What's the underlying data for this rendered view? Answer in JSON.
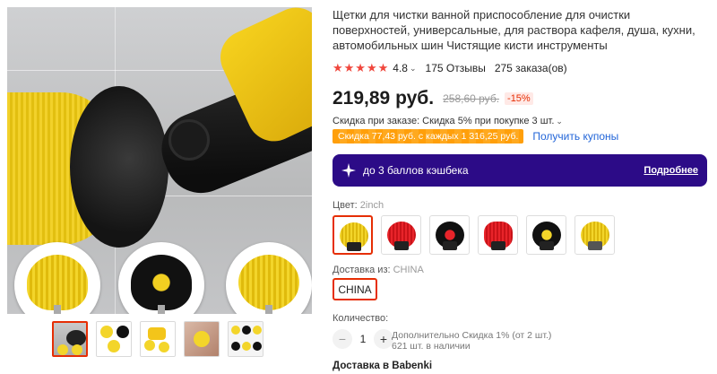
{
  "gallery": {
    "main_alt": "drill brush cleaning tiles",
    "thumbnails": [
      "thumb-1",
      "thumb-2",
      "thumb-3",
      "thumb-4",
      "thumb-5"
    ],
    "active_thumbnail": 0
  },
  "product": {
    "title": "Щетки для чистки ванной приспособление для очистки поверхностей, универсальные, для раствора кафеля, душа, кухни, автомобильных шин Чистящие кисти инструменты",
    "rating": "4.8",
    "stars": "★★★★★",
    "reviews": "175 Отзывы",
    "orders": "275 заказа(ов)"
  },
  "price": {
    "current": "219,89 руб.",
    "old": "258,60 руб.",
    "discount": "-15%"
  },
  "promo": {
    "order_discount": "Скидка при заказе: Скидка 5% при покупке 3 шт.",
    "coupon_tag": "Скидка 77,43 руб. с каждых 1 316,25 руб.",
    "coupon_link": "Получить купоны"
  },
  "cashback": {
    "text": "до 3 баллов кэшбека",
    "more": "Подробнее",
    "bg": "#2c0b87"
  },
  "color": {
    "label": "Цвет: ",
    "selected": "2inch",
    "swatches": [
      "yellow",
      "red",
      "black-red",
      "red-full",
      "black-yellow",
      "yellow-full"
    ]
  },
  "shipping": {
    "label": "Доставка из: ",
    "selected": "CHINA",
    "option": "CHINA"
  },
  "quantity": {
    "label": "Количество:",
    "value": "1",
    "minus": "−",
    "plus": "+",
    "note_line1": "Дополнительно Скидка 1% (от 2 шт.)",
    "note_line2": "621 шт. в наличии"
  },
  "delivery": {
    "label": "Доставка в Babenki"
  },
  "colors": {
    "accent": "#e62e04",
    "star": "#f0463c",
    "link": "#2265d8",
    "coupon": "#ff9f0a"
  }
}
